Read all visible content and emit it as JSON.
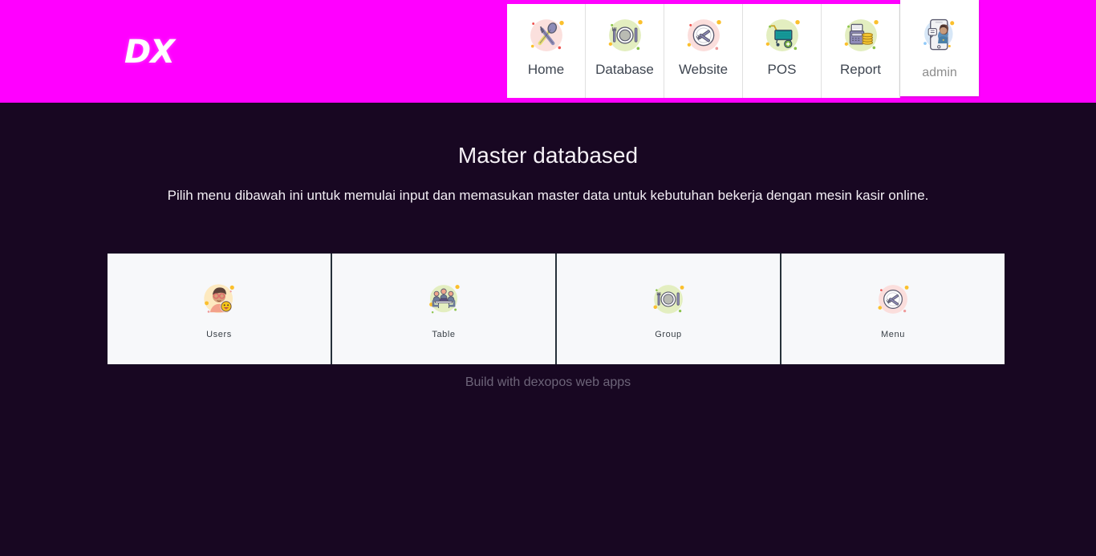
{
  "brand": {
    "logo_text": "DX",
    "header_color": "#ff00ff",
    "body_color": "#180722"
  },
  "nav": {
    "items": [
      {
        "label": "Home",
        "icon": "cutlery-crossed-icon",
        "active": false
      },
      {
        "label": "Database",
        "icon": "plate-setting-icon",
        "active": false
      },
      {
        "label": "Website",
        "icon": "plate-utensils-pink-icon",
        "active": false
      },
      {
        "label": "POS",
        "icon": "shopping-cart-icon",
        "active": false
      },
      {
        "label": "Report",
        "icon": "cash-register-icon",
        "active": false
      },
      {
        "label": "admin",
        "icon": "user-phone-icon",
        "active": true
      }
    ]
  },
  "main": {
    "title": "Master databased",
    "subtitle": "Pilih menu dibawah ini untuk memulai input dan memasukan master data untuk kebutuhan bekerja dengan mesin kasir online.",
    "cards": [
      {
        "label": "Users",
        "icon": "user-avatar-emoji-icon"
      },
      {
        "label": "Table",
        "icon": "meeting-table-icon"
      },
      {
        "label": "Group",
        "icon": "plate-setting-icon"
      },
      {
        "label": "Menu",
        "icon": "plate-utensils-pink-icon"
      }
    ]
  },
  "footer": {
    "text": "Build with dexopos web apps"
  }
}
